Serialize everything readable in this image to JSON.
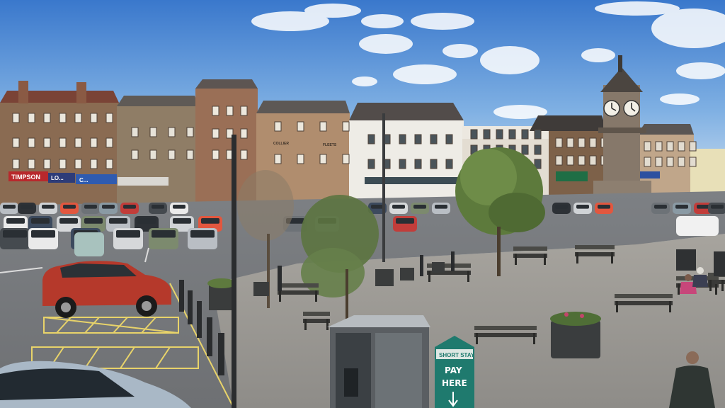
{
  "shop_signs": {
    "timpson": "TIMPSON",
    "sign_2": "LO...",
    "sign_3": "C...",
    "sign_4": "COLLIER",
    "sign_5": "FLEETS"
  },
  "parking_sign": {
    "line1": "SHORT STAY",
    "line2": "PAY",
    "line3": "HERE"
  },
  "colors": {
    "sky_top": "#3f7fd0",
    "sky_bottom": "#b9d3ee",
    "paving": "#9c9a96",
    "road": "#7b7d80",
    "red_car": "#b23a2a",
    "sign_teal": "#1f7a6e"
  }
}
